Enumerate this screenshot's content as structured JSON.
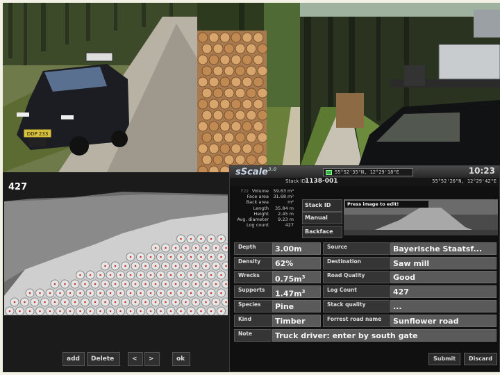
{
  "scan": {
    "count_label": "427",
    "buttons": {
      "add": "add",
      "delete": "Delete",
      "prev": "<",
      "next": ">",
      "ok": "ok"
    }
  },
  "app": {
    "logo": "sScale",
    "version": "3.0",
    "gps_top": "55°52'35\"N, 12°29'18\"E",
    "clock": "10:23",
    "stack_id_label": "Stack ID",
    "stack_id": "1138-001",
    "gps_sub": "55°52'26\"N, 12°29'42\"E",
    "tiny_code": "F22"
  },
  "stats": [
    {
      "k": "Volume",
      "v": "59.63 m³"
    },
    {
      "k": "Face area",
      "v": "31.68 m²"
    },
    {
      "k": "Back area",
      "v": "m²"
    },
    {
      "k": "Length",
      "v": "35.84 m"
    },
    {
      "k": "Height",
      "v": "2.45 m"
    },
    {
      "k": "Avg. diameter",
      "v": "9.23 m"
    },
    {
      "k": "Log count",
      "v": "427"
    }
  ],
  "side_buttons": {
    "stack_id": "Stack ID",
    "manual": "Manual",
    "backface": "Backface"
  },
  "preview_label": "Press image to edit!",
  "fields": {
    "depth": {
      "label": "Depth",
      "value": "3.00m"
    },
    "density": {
      "label": "Density",
      "value": "62%"
    },
    "wrecks": {
      "label": "Wrecks",
      "value": "0.75m",
      "unit": "3"
    },
    "supports": {
      "label": "Supports",
      "value": "1.47m",
      "unit": "3"
    },
    "species": {
      "label": "Species",
      "value": "Pine"
    },
    "kind": {
      "label": "Kind",
      "value": "Timber"
    },
    "source": {
      "label": "Source",
      "value": "Bayerische Staatsf..."
    },
    "destination": {
      "label": "Destination",
      "value": "Saw mill"
    },
    "road_quality": {
      "label": "Road Quality",
      "value": "Good"
    },
    "log_count": {
      "label": "Log Count",
      "value": "427"
    },
    "stack_quality": {
      "label": "Stack quality",
      "value": "..."
    },
    "forrest_road": {
      "label": "Forrest road name",
      "value": "Sunflower road"
    },
    "note": {
      "label": "Note",
      "value": "Truck driver: enter by south gate"
    }
  },
  "footer": {
    "submit": "Submit",
    "discard": "Discard"
  },
  "car_plate": "DDP 233",
  "colors": {
    "panel": "#101010",
    "value_bg": "#5a5a5a",
    "gps_green": "#3aa84a"
  }
}
